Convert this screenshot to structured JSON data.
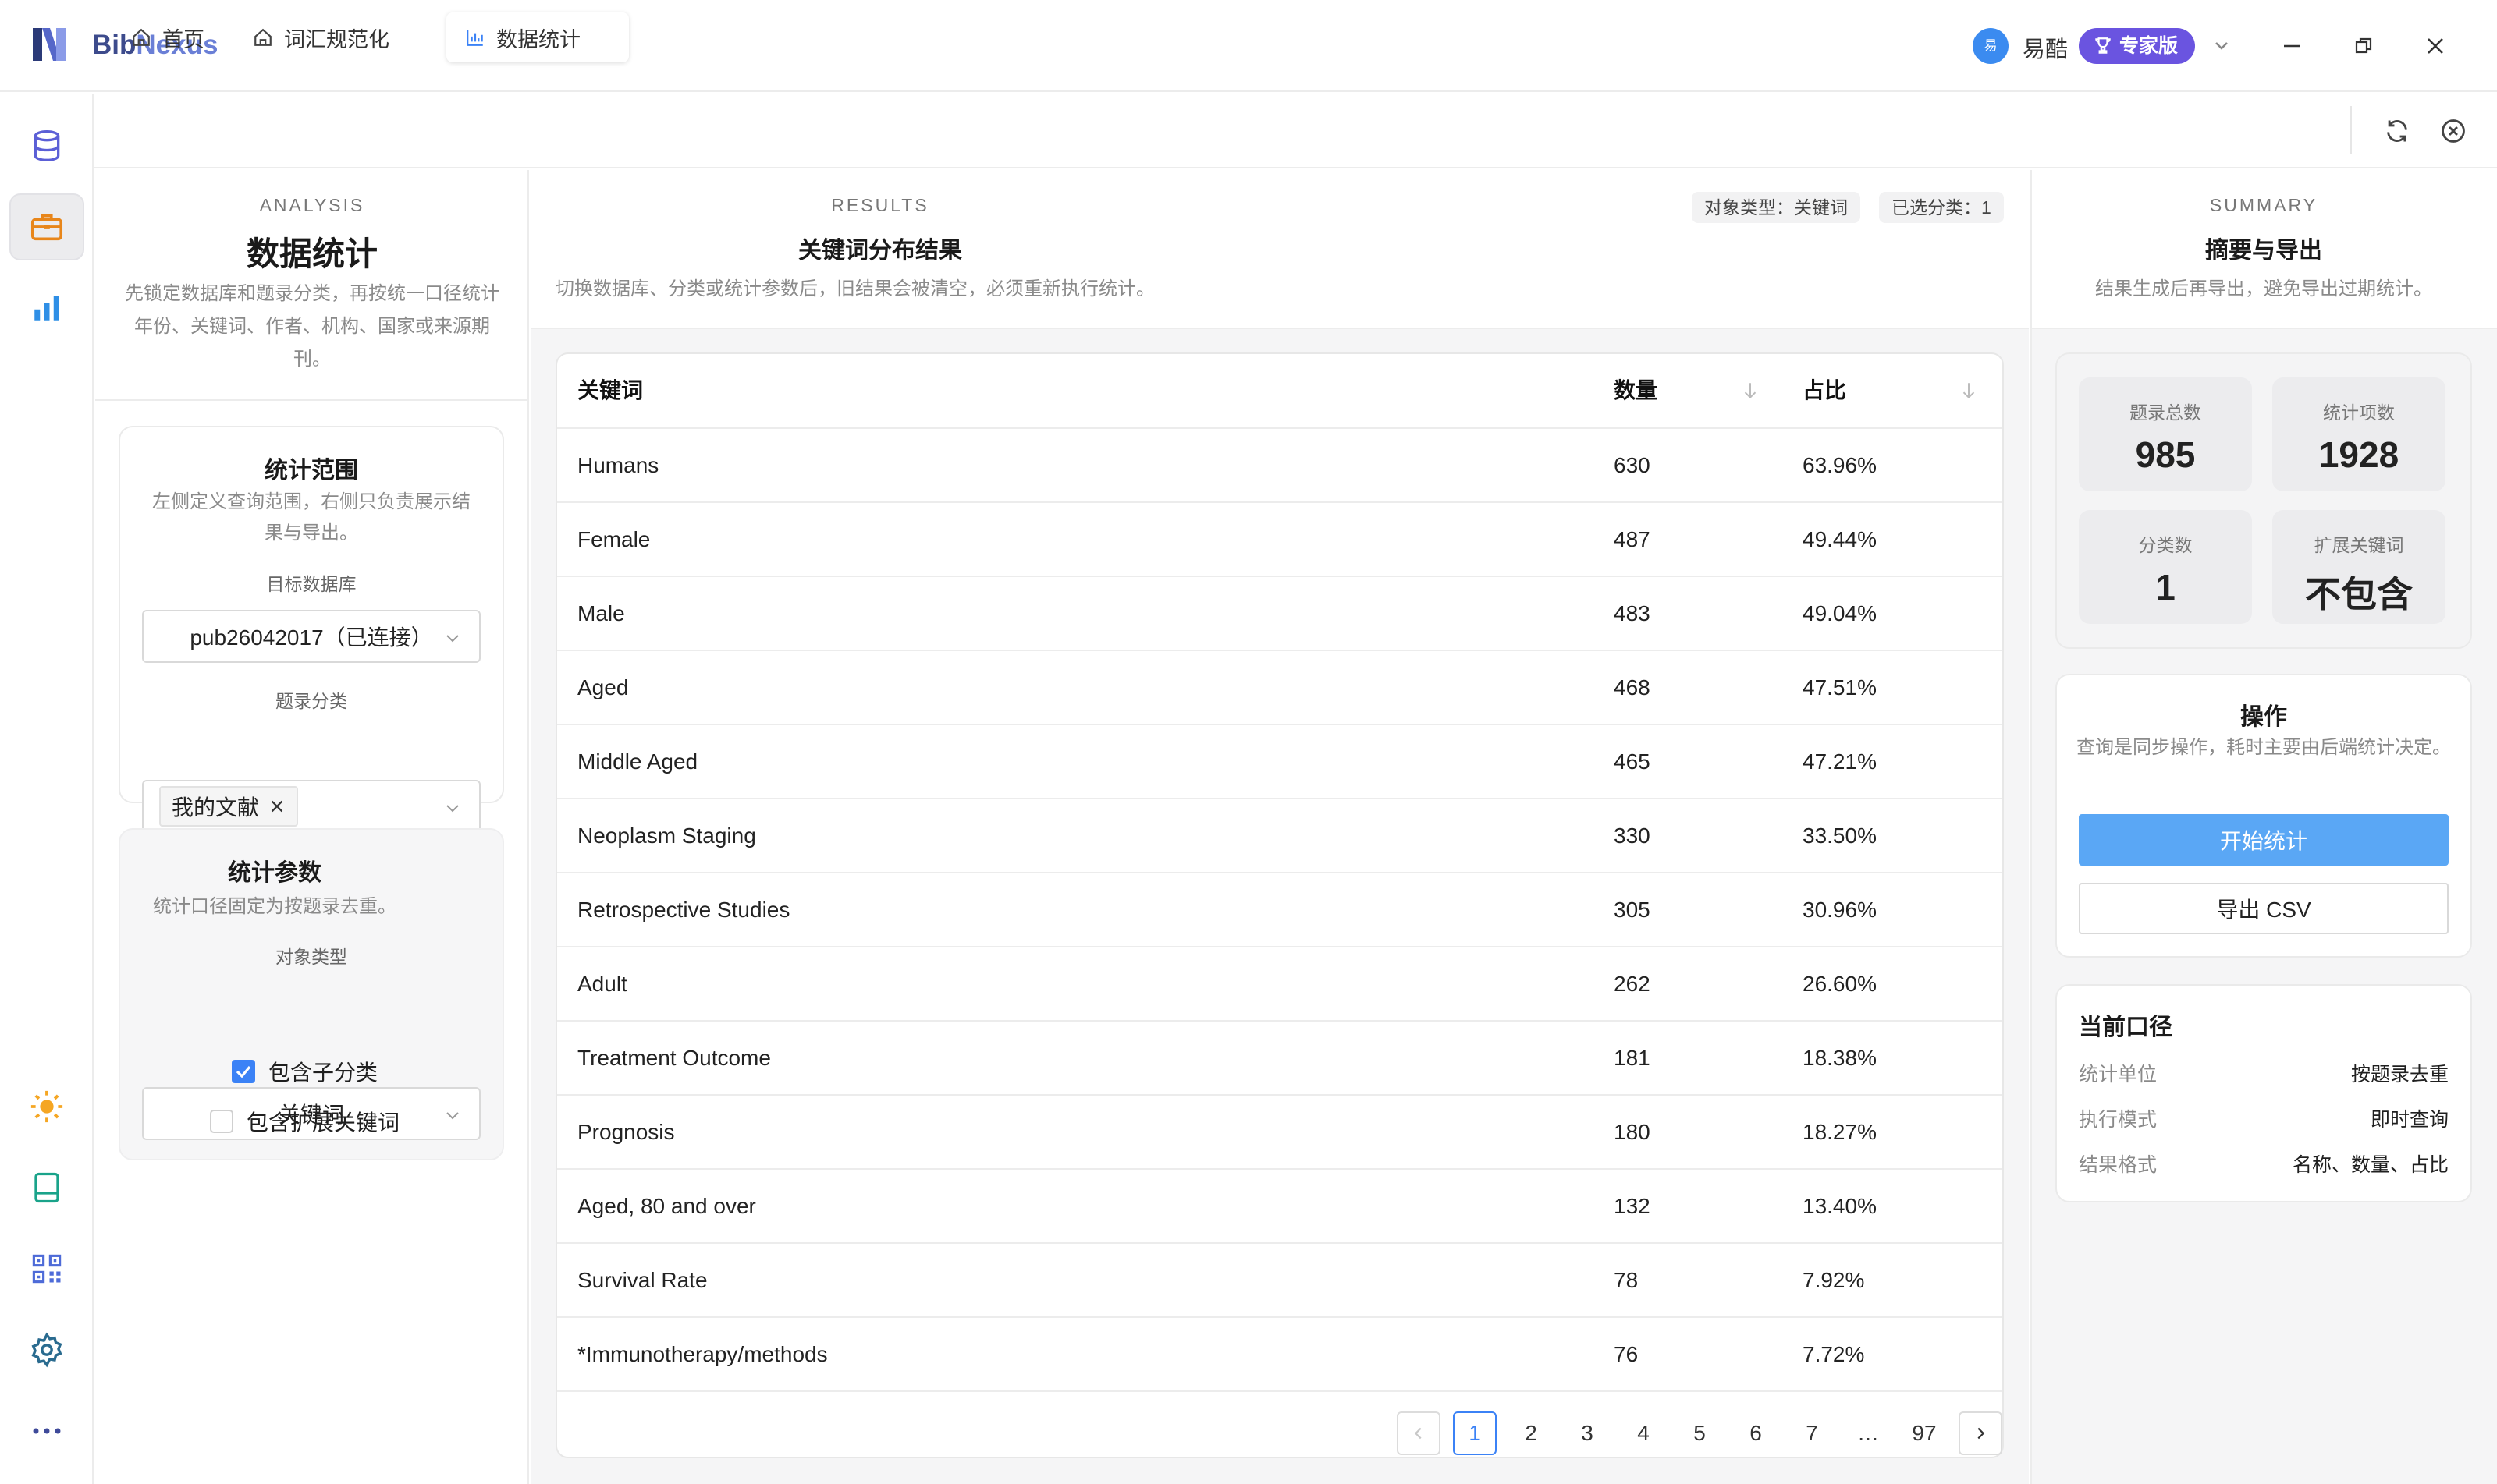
{
  "app": {
    "name_part1": "Bib",
    "name_part2": "Nexus"
  },
  "user": {
    "avatar_text": "易",
    "name": "易酷",
    "badge": "专家版"
  },
  "tabs": [
    {
      "label": "首页"
    },
    {
      "label": "词汇规范化"
    },
    {
      "label": "数据统计"
    }
  ],
  "left": {
    "overline": "ANALYSIS",
    "title": "数据统计",
    "description": "先锁定数据库和题录分类，再按统一口径统计年份、关键词、作者、机构、国家或来源期刊。",
    "scope": {
      "title": "统计范围",
      "description": "左侧定义查询范围，右侧只负责展示结果与导出。",
      "db_label": "目标数据库",
      "db_value": "pub26042017（已连接）",
      "category_label": "题录分类",
      "category_tag": "我的文献"
    },
    "params": {
      "title": "统计参数",
      "description": "统计口径固定为按题录去重。",
      "type_label": "对象类型",
      "type_value": "关键词",
      "include_sub": "包含子分类",
      "include_sub_checked": true,
      "include_ext": "包含扩展关键词",
      "include_ext_checked": false
    }
  },
  "results": {
    "overline": "RESULTS",
    "title": "关键词分布结果",
    "description": "切换数据库、分类或统计参数后，旧结果会被清空，必须重新执行统计。",
    "chip_type": "对象类型：关键词",
    "chip_selected": "已选分类：1",
    "columns": [
      "关键词",
      "数量",
      "占比"
    ],
    "rows": [
      {
        "name": "Humans",
        "count": "630",
        "pct": "63.96%"
      },
      {
        "name": "Female",
        "count": "487",
        "pct": "49.44%"
      },
      {
        "name": "Male",
        "count": "483",
        "pct": "49.04%"
      },
      {
        "name": "Aged",
        "count": "468",
        "pct": "47.51%"
      },
      {
        "name": "Middle Aged",
        "count": "465",
        "pct": "47.21%"
      },
      {
        "name": "Neoplasm Staging",
        "count": "330",
        "pct": "33.50%"
      },
      {
        "name": "Retrospective Studies",
        "count": "305",
        "pct": "30.96%"
      },
      {
        "name": "Adult",
        "count": "262",
        "pct": "26.60%"
      },
      {
        "name": "Treatment Outcome",
        "count": "181",
        "pct": "18.38%"
      },
      {
        "name": "Prognosis",
        "count": "180",
        "pct": "18.27%"
      },
      {
        "name": "Aged, 80 and over",
        "count": "132",
        "pct": "13.40%"
      },
      {
        "name": "Survival Rate",
        "count": "78",
        "pct": "7.92%"
      },
      {
        "name": "*Immunotherapy/methods",
        "count": "76",
        "pct": "7.72%"
      }
    ],
    "pagination": {
      "pages": [
        "1",
        "2",
        "3",
        "4",
        "5",
        "6",
        "7",
        "…",
        "97"
      ],
      "current": "1"
    }
  },
  "summary": {
    "overline": "SUMMARY",
    "title": "摘要与导出",
    "description": "结果生成后再导出，避免导出过期统计。",
    "stats": [
      {
        "label": "题录总数",
        "value": "985"
      },
      {
        "label": "统计项数",
        "value": "1928"
      },
      {
        "label": "分类数",
        "value": "1"
      },
      {
        "label": "扩展关键词",
        "value": "不包含"
      }
    ],
    "actions": {
      "title": "操作",
      "description": "查询是同步操作，耗时主要由后端统计决定。",
      "start": "开始统计",
      "export": "导出 CSV"
    },
    "caliber": {
      "title": "当前口径",
      "items": [
        {
          "key": "统计单位",
          "value": "按题录去重"
        },
        {
          "key": "执行模式",
          "value": "即时查询"
        },
        {
          "key": "结果格式",
          "value": "名称、数量、占比"
        }
      ]
    }
  },
  "colors": {
    "accent": "#3b82f6",
    "badge": "#6a54e0",
    "primary_button": "#5aa7f5"
  }
}
